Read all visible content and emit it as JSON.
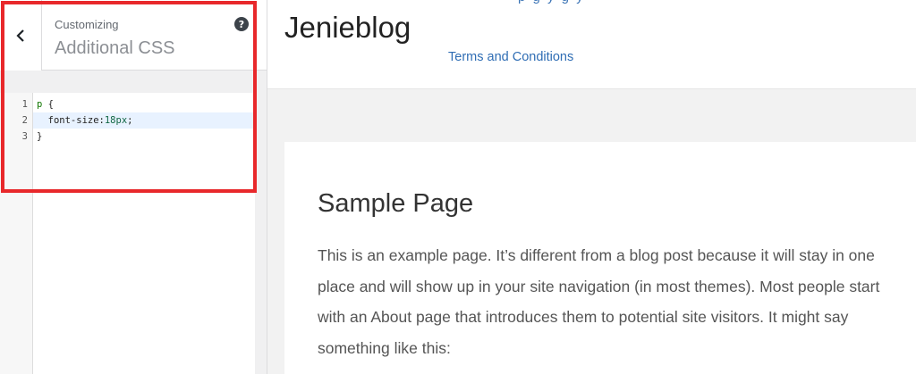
{
  "customizer": {
    "breadcrumb": "Customizing",
    "section_title": "Additional CSS",
    "help_label": "?"
  },
  "editor": {
    "lines": [
      {
        "num": "1",
        "selector": "p",
        "rest": " {"
      },
      {
        "num": "2",
        "property": "  font-size:",
        "value": "18px",
        "end": ";"
      },
      {
        "num": "3",
        "text": "}"
      }
    ]
  },
  "preview": {
    "site_title": "Jenieblog",
    "terms_link": "Terms and Conditions",
    "page_title": "Sample Page",
    "page_body": "This is an example page. It’s different from a blog post because it will stay in one place and will show up in your site navigation (in most themes). Most people start with an About page that introduces them to potential site visitors. It might say something like this:"
  },
  "colors": {
    "highlight": "#e8282b",
    "link": "#2f6db4"
  }
}
